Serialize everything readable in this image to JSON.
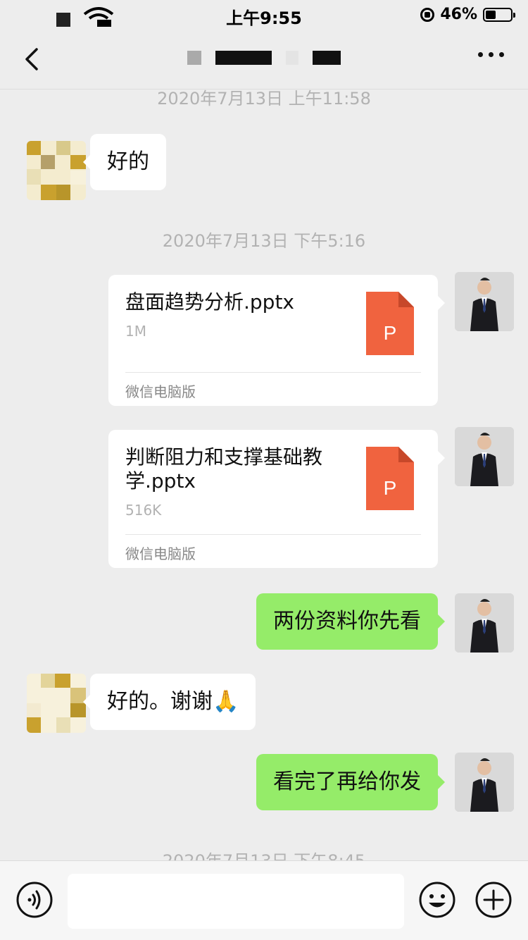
{
  "status_bar": {
    "time": "上午9:55",
    "battery": "46%"
  },
  "timestamps": {
    "t1": "2020年7月13日 上午11:58",
    "t2": "2020年7月13日 下午5:16",
    "t3": "2020年7月13日 下午8:45"
  },
  "messages": {
    "m1": "好的",
    "file1": {
      "name": "盘面趋势分析.pptx",
      "size": "1M",
      "source": "微信电脑版",
      "icon_letter": "P"
    },
    "file2": {
      "name": "判断阻力和支撑基础教学.pptx",
      "size": "516K",
      "source": "微信电脑版",
      "icon_letter": "P"
    },
    "m2": "两份资料你先看",
    "m3": "好的。谢谢🙏",
    "m4": "看完了再给你发"
  },
  "colors": {
    "bubble_green": "#95ec69",
    "ppt_orange": "#f0633f",
    "background": "#ededed"
  },
  "icons": [
    "back-chevron-icon",
    "more-dots-icon",
    "voice-icon",
    "emoji-icon",
    "plus-icon",
    "ppt-file-icon"
  ]
}
